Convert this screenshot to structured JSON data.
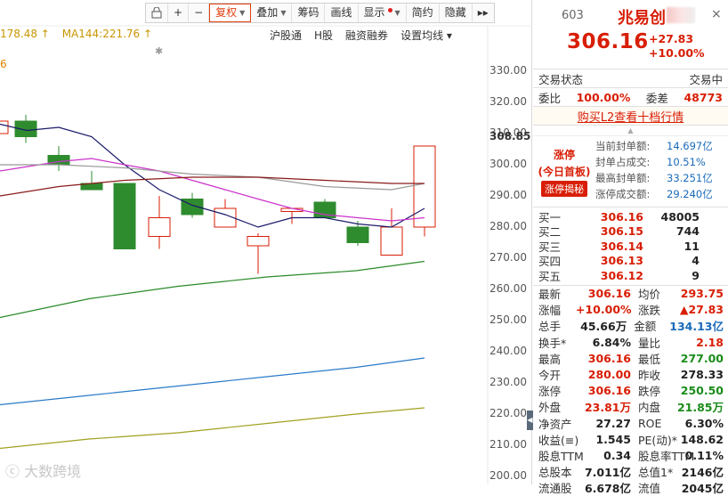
{
  "toolbar": {
    "items": [
      {
        "label": "",
        "icon": "lock-icon"
      },
      {
        "label": "+"
      },
      {
        "label": "−"
      },
      {
        "label": "复权",
        "dropdown": true,
        "active": true
      },
      {
        "label": "叠加",
        "dropdown": true
      },
      {
        "label": "筹码"
      },
      {
        "label": "画线"
      },
      {
        "label": "显示",
        "dropdown": true,
        "dot": true
      },
      {
        "label": "简约"
      },
      {
        "label": "隐藏"
      },
      {
        "label": "▸▸",
        "icon": "double-chevron-right-icon"
      }
    ]
  },
  "ma_legend": {
    "ma_a": "178.48 ↑",
    "ma_b": "MA144:221.76 ↑",
    "left_digit": "6"
  },
  "links": [
    "沪股通",
    "H股",
    "融资融券",
    "设置均线 ▾"
  ],
  "price_axis": {
    "ticks": [
      "330.00",
      "320.00",
      "310.00",
      "300.00",
      "290.00",
      "280.00",
      "270.00",
      "260.00",
      "250.00",
      "240.00",
      "230.00",
      "220.00",
      "210.00",
      "200.00"
    ],
    "current": "308.85"
  },
  "watermark": "ⓒ 大数跨境",
  "quote": {
    "code": "603",
    "name": "兆易创",
    "price": "306.16",
    "change": "+27.83",
    "change_pct": "+10.00%",
    "state_label": "交易状态",
    "state_value": "交易中",
    "weibi_label": "委比",
    "weibi_value": "100.00%",
    "weicha_label": "委差",
    "weicha_value": "48773",
    "l2_link": "购买L2查看十档行情"
  },
  "limit_up": {
    "title": "涨停",
    "subtitle": "(今日首板)",
    "button": "涨停揭秘",
    "rows": [
      {
        "k": "当前封单额:",
        "v": "14.697亿"
      },
      {
        "k": "封单占成交:",
        "v": "10.51%"
      },
      {
        "k": "最高封单额:",
        "v": "33.251亿"
      },
      {
        "k": "涨停成交额:",
        "v": "29.240亿"
      }
    ]
  },
  "order_book": [
    {
      "name": "买一",
      "price": "306.16",
      "qty": "48005"
    },
    {
      "name": "买二",
      "price": "306.15",
      "qty": "744"
    },
    {
      "name": "买三",
      "price": "306.14",
      "qty": "11"
    },
    {
      "name": "买四",
      "price": "306.13",
      "qty": "4"
    },
    {
      "name": "买五",
      "price": "306.12",
      "qty": "9"
    }
  ],
  "stats": [
    {
      "k1": "最新",
      "v1": "306.16",
      "c1": "red",
      "k2": "均价",
      "v2": "293.75",
      "c2": "red"
    },
    {
      "k1": "涨幅",
      "v1": "+10.00%",
      "c1": "red",
      "k2": "涨跌",
      "v2": "▲27.83",
      "c2": "red"
    },
    {
      "k1": "总手",
      "v1": "45.66万",
      "c1": "bold",
      "k2": "金额",
      "v2": "134.13亿",
      "c2": "blue"
    },
    {
      "k1": "换手*",
      "v1": "6.84%",
      "c1": "bold",
      "k2": "量比",
      "v2": "2.18",
      "c2": "red"
    },
    {
      "k1": "最高",
      "v1": "306.16",
      "c1": "red",
      "k2": "最低",
      "v2": "277.00",
      "c2": "green"
    },
    {
      "k1": "今开",
      "v1": "280.00",
      "c1": "red",
      "k2": "昨收",
      "v2": "278.33",
      "c2": "bold"
    },
    {
      "k1": "涨停",
      "v1": "306.16",
      "c1": "red",
      "k2": "跌停",
      "v2": "250.50",
      "c2": "green"
    },
    {
      "k1": "外盘",
      "v1": "23.81万",
      "c1": "red",
      "k2": "内盘",
      "v2": "21.85万",
      "c2": "green"
    },
    {
      "k1": "净资产",
      "v1": "27.27",
      "c1": "bold",
      "k2": "ROE",
      "v2": "6.30%",
      "c2": "bold"
    },
    {
      "k1": "收益(≡)",
      "v1": "1.545",
      "c1": "bold",
      "k2": "PE(动)*",
      "v2": "148.62",
      "c2": "bold"
    },
    {
      "k1": "股息TTM",
      "v1": "0.34",
      "c1": "bold",
      "k2": "股息率TTM",
      "v2": "0.11%",
      "c2": "bold"
    },
    {
      "k1": "总股本",
      "v1": "7.011亿",
      "c1": "bold",
      "k2": "总值1*",
      "v2": "2146亿",
      "c2": "bold"
    },
    {
      "k1": "流通股",
      "v1": "6.678亿",
      "c1": "bold",
      "k2": "流值",
      "v2": "2045亿",
      "c2": "bold"
    }
  ],
  "candles": [
    {
      "o": 310,
      "h": 315,
      "l": 306,
      "c": 314
    },
    {
      "o": 314,
      "h": 316,
      "l": 307,
      "c": 309
    },
    {
      "o": 303,
      "h": 306,
      "l": 298,
      "c": 300
    },
    {
      "o": 294,
      "h": 298,
      "l": 292,
      "c": 292
    },
    {
      "o": 294,
      "h": 294,
      "l": 273,
      "c": 273
    },
    {
      "o": 277,
      "h": 290,
      "l": 273,
      "c": 283
    },
    {
      "o": 289,
      "h": 291,
      "l": 283,
      "c": 284
    },
    {
      "o": 280,
      "h": 289,
      "l": 280,
      "c": 286
    },
    {
      "o": 274,
      "h": 278,
      "l": 265,
      "c": 277
    },
    {
      "o": 285,
      "h": 286,
      "l": 281,
      "c": 286
    },
    {
      "o": 288,
      "h": 289,
      "l": 283,
      "c": 283
    },
    {
      "o": 280,
      "h": 282,
      "l": 274,
      "c": 275
    },
    {
      "o": 271,
      "h": 286,
      "l": 271,
      "c": 280
    },
    {
      "o": 280,
      "h": 306,
      "l": 277,
      "c": 306
    }
  ]
}
